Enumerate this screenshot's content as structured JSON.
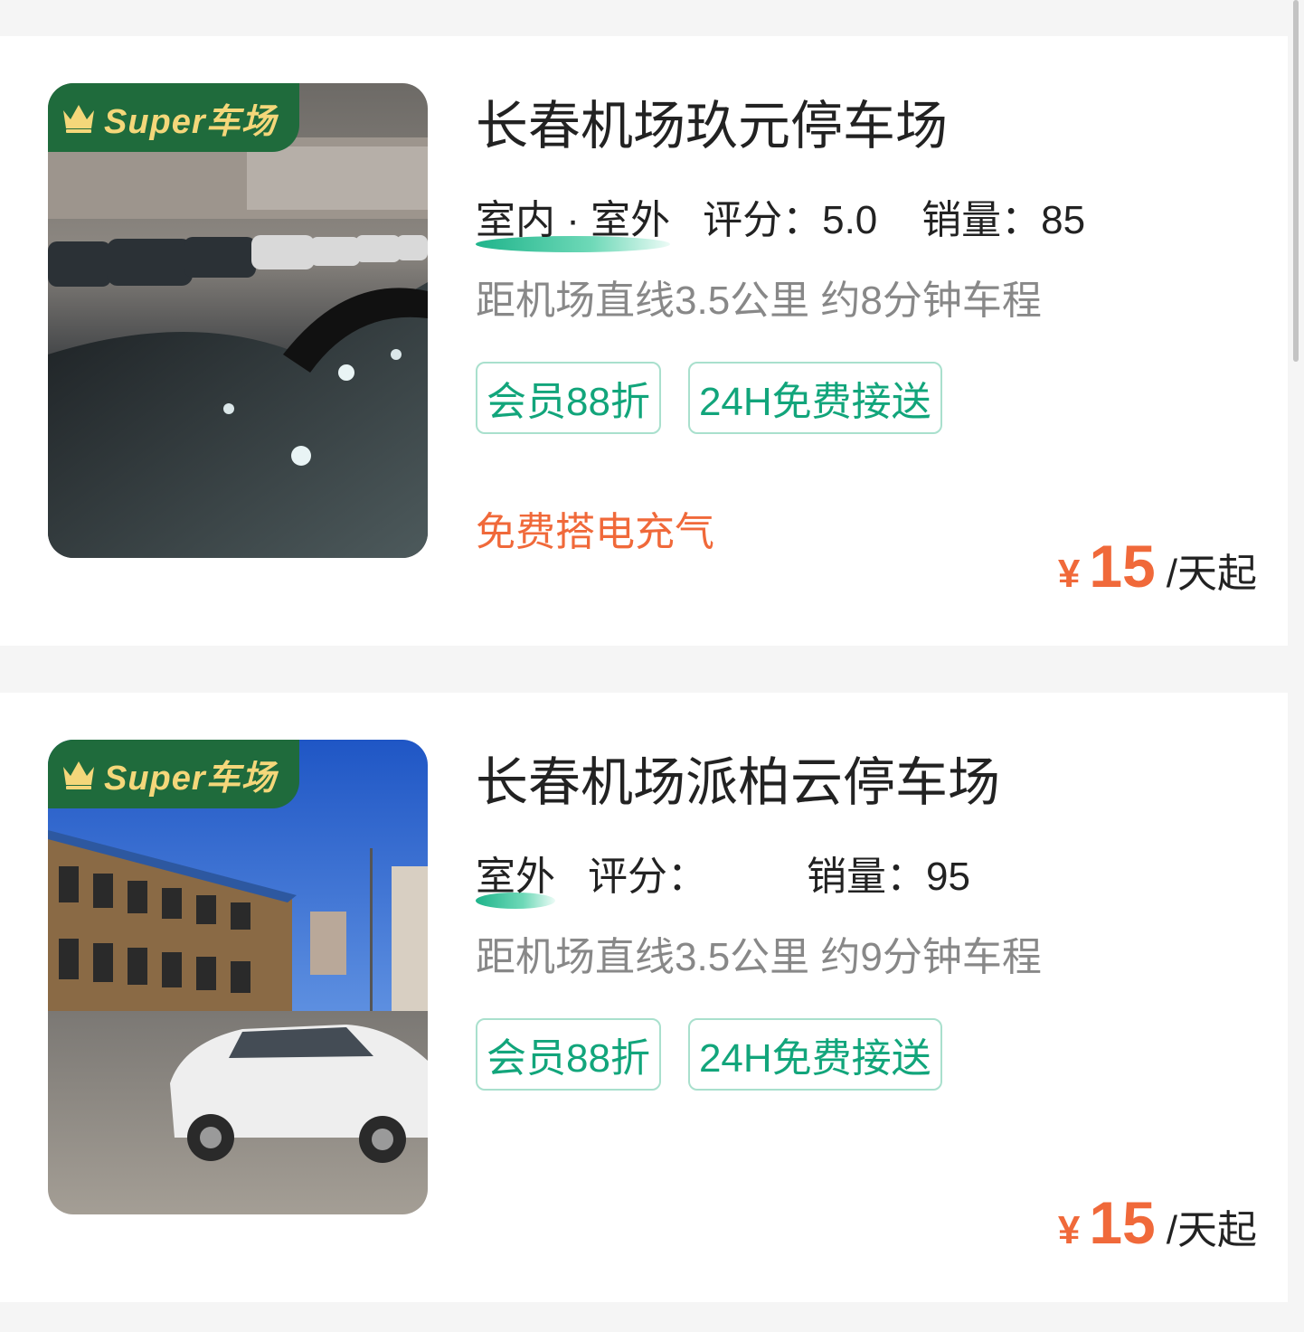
{
  "listings": [
    {
      "badge": "Super车场",
      "name": "长春机场玖元停车场",
      "types": "室内 · 室外",
      "rating_label": "评分：",
      "rating": "5.0",
      "sales_label": "销量：",
      "sales": "85",
      "distance": "距机场直线3.5公里 约8分钟车程",
      "tags": [
        "会员88折",
        "24H免费接送"
      ],
      "promo": "免费搭电充气",
      "currency": "¥",
      "price": "15",
      "price_unit": "/天起"
    },
    {
      "badge": "Super车场",
      "name": "长春机场派柏云停车场",
      "types": "室外",
      "rating_label": "评分：",
      "rating": "",
      "sales_label": "销量：",
      "sales": "95",
      "distance": "距机场直线3.5公里 约9分钟车程",
      "tags": [
        "会员88折",
        "24H免费接送"
      ],
      "promo": "",
      "currency": "¥",
      "price": "15",
      "price_unit": "/天起"
    }
  ],
  "colors": {
    "accent_green": "#12a57b",
    "badge_green": "#1f6b3c",
    "badge_text": "#f4d77a",
    "price_orange": "#f0693a"
  },
  "icons": {
    "badge_icon": "crown-icon"
  }
}
